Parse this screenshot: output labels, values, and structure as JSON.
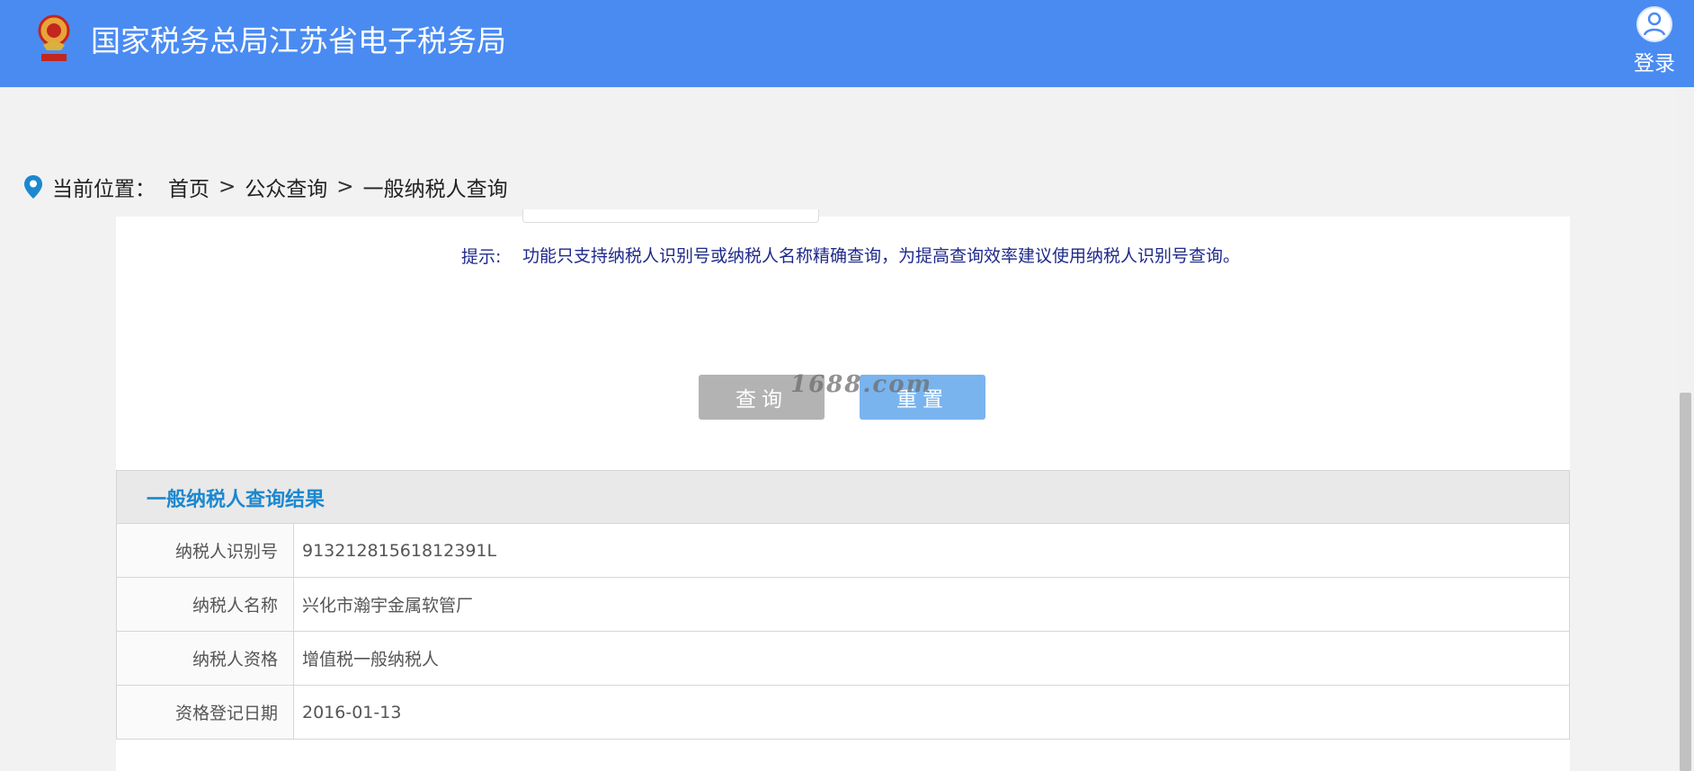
{
  "header": {
    "title": "国家税务总局江苏省电子税务局",
    "login_label": "登录",
    "emblem_icon": "tax-emblem-icon",
    "avatar_icon": "user-avatar-icon",
    "bg_color": "#4a8bf2"
  },
  "breadcrumb": {
    "prefix": "当前位置：",
    "items": [
      "首页",
      "公众查询",
      "一般纳税人查询"
    ],
    "separator": ">",
    "icon": "location-pin-icon"
  },
  "search": {
    "hint_label": "提示:",
    "hint_text": "功能只支持纳税人识别号或纳税人名称精确查询，为提高查询效率建议使用纳税人识别号查询。",
    "query_button": "查询",
    "reset_button": "重置"
  },
  "watermark": "1688.com",
  "result": {
    "title": "一般纳税人查询结果",
    "rows": [
      {
        "label": "纳税人识别号",
        "value": "91321281561812391L"
      },
      {
        "label": "纳税人名称",
        "value": "兴化市瀚宇金属软管厂"
      },
      {
        "label": "纳税人资格",
        "value": "增值税一般纳税人"
      },
      {
        "label": "资格登记日期",
        "value": "2016-01-13"
      }
    ]
  }
}
